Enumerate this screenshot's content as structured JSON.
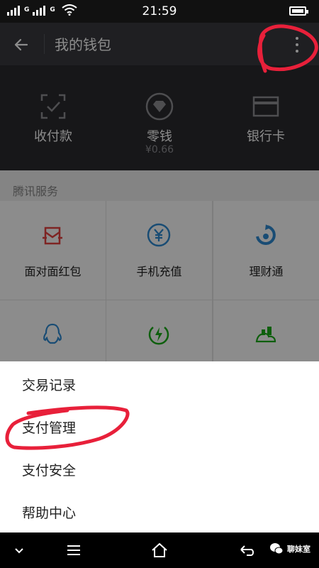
{
  "status_bar": {
    "time": "21:59",
    "network_label_1": "G",
    "network_label_2": "G"
  },
  "header": {
    "title": "我的钱包"
  },
  "wallet_top": [
    {
      "label": "收付款",
      "icon": "scan-icon"
    },
    {
      "label": "零钱",
      "sub": "¥0.66",
      "icon": "diamond-icon"
    },
    {
      "label": "银行卡",
      "icon": "bank-card-icon"
    }
  ],
  "services": {
    "section_label": "腾讯服务",
    "items": [
      {
        "label": "面对面红包",
        "icon": "red-packet-icon",
        "color": "#e64340"
      },
      {
        "label": "手机充值",
        "icon": "yuan-coin-icon",
        "color": "#2f8bd3"
      },
      {
        "label": "理财通",
        "icon": "licaitong-icon",
        "color": "#2f8bd3"
      },
      {
        "label": "",
        "icon": "qq-penguin-icon",
        "color": "#2f8bd3"
      },
      {
        "label": "",
        "icon": "lightning-icon",
        "color": "#1aad19"
      },
      {
        "label": "",
        "icon": "city-icon",
        "color": "#1aad19"
      }
    ]
  },
  "menu": {
    "items": [
      "交易记录",
      "支付管理",
      "支付安全",
      "帮助中心"
    ]
  },
  "watermark": {
    "text": "聊妹室"
  },
  "colors": {
    "titlebar": "#393a3f",
    "annotation": "#e8203a"
  }
}
